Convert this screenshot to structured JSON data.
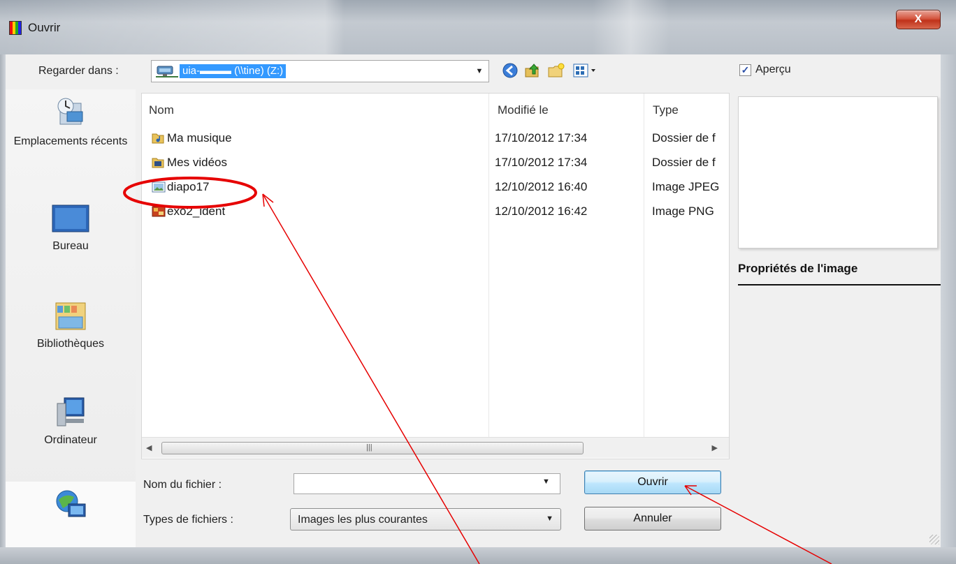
{
  "window": {
    "title": "Ouvrir",
    "close_label": "X"
  },
  "toolbar": {
    "look_in_label": "Regarder dans :",
    "look_in_value": "uia-▬▬▬ (\\\\tine) (Z:)",
    "preview_label": "Aperçu",
    "preview_checked": true,
    "icons": [
      "back-icon",
      "up-folder-icon",
      "new-folder-icon",
      "views-menu-icon"
    ]
  },
  "places": [
    {
      "label": "Emplacements récents",
      "icon": "recent-places-icon"
    },
    {
      "label": "Bureau",
      "icon": "desktop-icon"
    },
    {
      "label": "Bibliothèques",
      "icon": "libraries-icon"
    },
    {
      "label": "Ordinateur",
      "icon": "computer-icon"
    },
    {
      "label": "",
      "icon": "network-icon"
    }
  ],
  "file_list": {
    "columns": [
      "Nom",
      "Modifié le",
      "Type"
    ],
    "rows": [
      {
        "name": "Ma musique",
        "modified": "17/10/2012 17:34",
        "type": "Dossier de f",
        "icon": "music-folder-icon"
      },
      {
        "name": "Mes vidéos",
        "modified": "17/10/2012 17:34",
        "type": "Dossier de f",
        "icon": "video-folder-icon"
      },
      {
        "name": "diapo17",
        "modified": "12/10/2012 16:40",
        "type": "Image JPEG",
        "icon": "jpeg-file-icon"
      },
      {
        "name": "exo2_ident",
        "modified": "12/10/2012 16:42",
        "type": "Image PNG",
        "icon": "png-file-icon"
      }
    ]
  },
  "preview": {
    "properties_title": "Propriétés de l'image"
  },
  "form": {
    "file_name_label": "Nom du fichier :",
    "file_name_value": "",
    "file_type_label": "Types de fichiers :",
    "file_type_value": "Images les plus courantes"
  },
  "buttons": {
    "open_label": "Ouvrir",
    "cancel_label": "Annuler"
  },
  "colors": {
    "selection": "#3399ff",
    "annotation": "#e60000",
    "close_button": "#c0321a"
  }
}
